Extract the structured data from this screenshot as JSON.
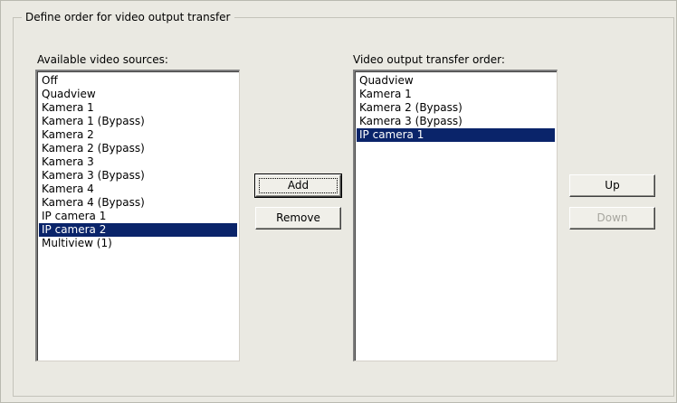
{
  "group": {
    "title": "Define order for video output transfer"
  },
  "available": {
    "label": "Available video sources:",
    "items": [
      {
        "label": "Off",
        "selected": false
      },
      {
        "label": "Quadview",
        "selected": false
      },
      {
        "label": "Kamera 1",
        "selected": false
      },
      {
        "label": "Kamera 1 (Bypass)",
        "selected": false
      },
      {
        "label": "Kamera 2",
        "selected": false
      },
      {
        "label": "Kamera 2 (Bypass)",
        "selected": false
      },
      {
        "label": "Kamera 3",
        "selected": false
      },
      {
        "label": "Kamera 3 (Bypass)",
        "selected": false
      },
      {
        "label": "Kamera 4",
        "selected": false
      },
      {
        "label": "Kamera 4 (Bypass)",
        "selected": false
      },
      {
        "label": "IP camera 1",
        "selected": false
      },
      {
        "label": "IP camera 2",
        "selected": true
      },
      {
        "label": "Multiview (1)",
        "selected": false
      }
    ]
  },
  "order": {
    "label": "Video output transfer order:",
    "items": [
      {
        "label": "Quadview",
        "selected": false
      },
      {
        "label": "Kamera 1",
        "selected": false
      },
      {
        "label": "Kamera 2 (Bypass)",
        "selected": false
      },
      {
        "label": "Kamera 3 (Bypass)",
        "selected": false
      },
      {
        "label": "IP camera 1",
        "selected": true
      }
    ]
  },
  "buttons": {
    "add": "Add",
    "remove": "Remove",
    "up": "Up",
    "down": "Down"
  },
  "colors": {
    "selection": "#0a246a",
    "disabled_text": "#a7a69f"
  }
}
